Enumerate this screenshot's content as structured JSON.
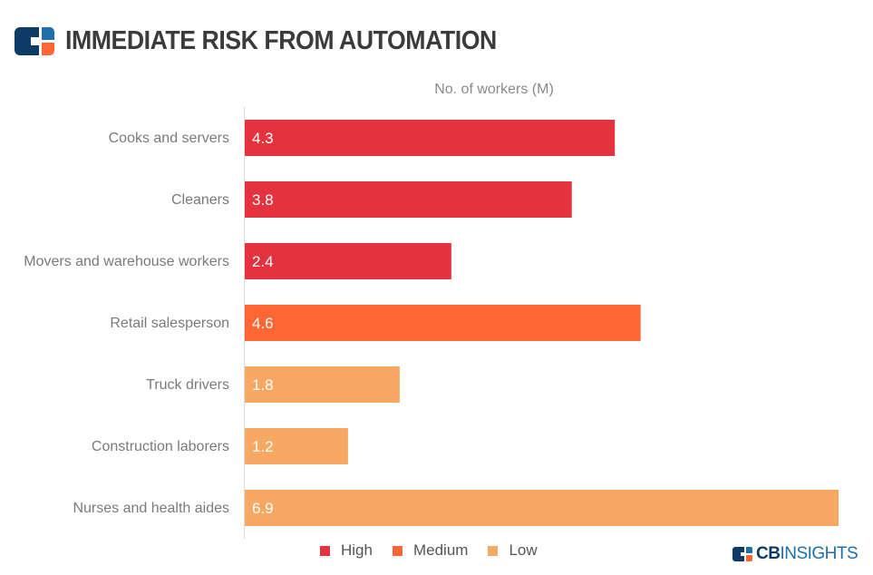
{
  "header": {
    "title": "IMMEDIATE RISK FROM AUTOMATION",
    "logo_colors": {
      "primary": "#0c3b66",
      "top_right": "#1f6fa8",
      "bottom_right": "#ff6633"
    }
  },
  "chart_data": {
    "type": "bar",
    "orientation": "horizontal",
    "title": "IMMEDIATE RISK FROM AUTOMATION",
    "xlabel": "No. of workers (M)",
    "ylabel": "",
    "xlim": [
      0,
      6.9
    ],
    "grid": false,
    "legend_position": "bottom",
    "categories": [
      "Cooks and servers",
      "Cleaners",
      "Movers and warehouse workers",
      "Retail salesperson",
      "Truck drivers",
      "Construction laborers",
      "Nurses and health aides"
    ],
    "values": [
      4.3,
      3.8,
      2.4,
      4.6,
      1.8,
      1.2,
      6.9
    ],
    "value_labels": [
      "4.3",
      "3.8",
      "2.4",
      "4.6",
      "1.8",
      "1.2",
      "6.9"
    ],
    "risk": [
      "High",
      "High",
      "High",
      "Medium",
      "Low",
      "Low",
      "Low"
    ],
    "legend": [
      {
        "name": "High",
        "color": "#e5323f"
      },
      {
        "name": "Medium",
        "color": "#ff6633"
      },
      {
        "name": "Low",
        "color": "#f7a862"
      }
    ]
  },
  "branding": {
    "cb": "CB",
    "insights": "INSIGHTS"
  }
}
